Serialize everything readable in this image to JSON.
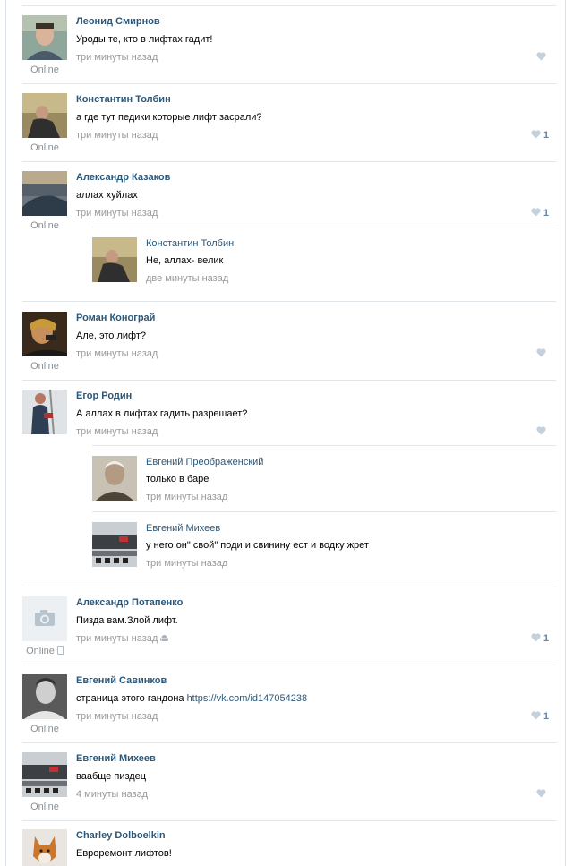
{
  "colors": {
    "author": "#2b587a",
    "muted": "#999999",
    "like": "#6a83a0",
    "separator": "#e1e6ea"
  },
  "comments": [
    {
      "author": "Леонид Смирнов",
      "text": "Уроды те, кто в лифтах гадит!",
      "date": "три минуты назад",
      "online": "Online",
      "likes": ""
    },
    {
      "author": "Константин Толбин",
      "text": "а где тут педики которые лифт засрали?",
      "date": "три минуты назад",
      "online": "Online",
      "likes": "1"
    },
    {
      "author": "Александр Казаков",
      "text": "аллах хуйлах",
      "date": "три минуты назад",
      "online": "Online",
      "likes": "1",
      "replies": [
        {
          "author": "Константин Толбин",
          "text": "Не, аллах- велик",
          "date": "две минуты назад"
        }
      ]
    },
    {
      "author": "Роман Конограй",
      "text": "Але, это лифт?",
      "date": "три минуты назад",
      "online": "Online",
      "likes": ""
    },
    {
      "author": "Егор Родин",
      "text": "А аллах в лифтах гадить разрешает?",
      "date": "три минуты назад",
      "online": "",
      "likes": "",
      "replies": [
        {
          "author": "Евгений Преображенский",
          "text": "только в баре",
          "date": "три минуты назад"
        },
        {
          "author": "Евгений Михеев",
          "text": "у него он\" свой\" поди и свинину ест и водку жрет",
          "date": "три минуты назад"
        }
      ]
    },
    {
      "author": "Александр Потапенко",
      "text": "Пизда вам.Злой лифт.",
      "date": "три минуты назад",
      "online": "Online",
      "likes": "1"
    },
    {
      "author": "Евгений Савинков",
      "text": "страница этого гандона ",
      "link": "https://vk.com/id147054238",
      "date": "три минуты назад",
      "online": "Online",
      "likes": "1"
    },
    {
      "author": "Евгений Михеев",
      "text": "ваабще пиздец",
      "date": "4 минуты назад",
      "online": "Online",
      "likes": ""
    },
    {
      "author": "Charley Dolboelkin",
      "text": "Евроремонт лифтов!",
      "date": "",
      "online": "",
      "likes": ""
    }
  ]
}
